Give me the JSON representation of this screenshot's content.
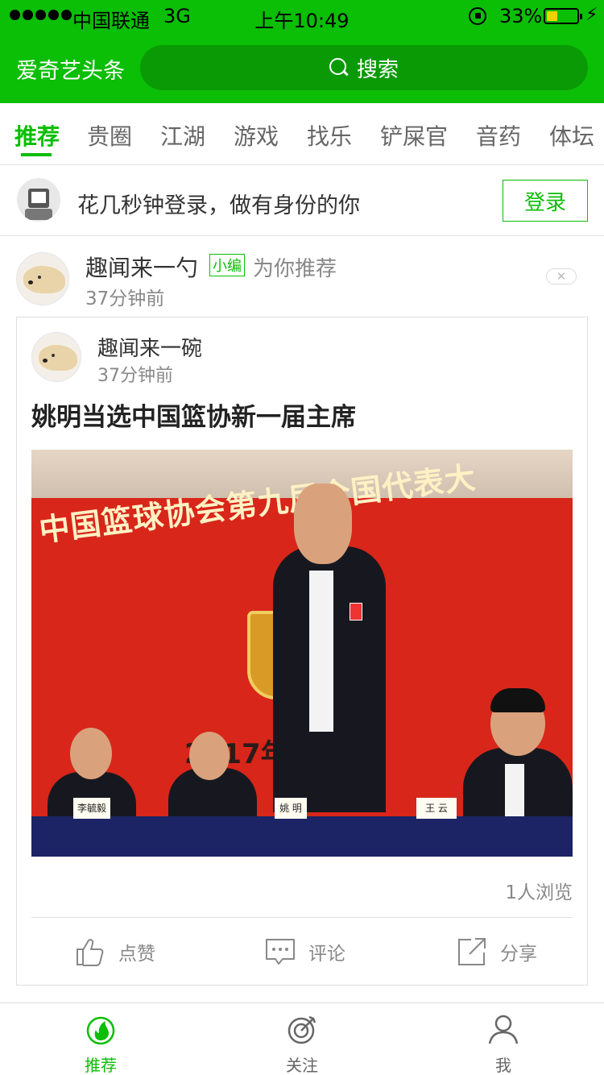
{
  "status_bar": {
    "carrier": "中国联通",
    "network": "3G",
    "time": "上午10:49",
    "battery": "33%"
  },
  "header": {
    "app_title": "爱奇艺头条",
    "search_label": "搜索"
  },
  "tabs": [
    {
      "label": "推荐",
      "active": true
    },
    {
      "label": "贵圈"
    },
    {
      "label": "江湖"
    },
    {
      "label": "游戏"
    },
    {
      "label": "找乐"
    },
    {
      "label": "铲屎官"
    },
    {
      "label": "音药"
    },
    {
      "label": "体坛"
    }
  ],
  "login_bar": {
    "text": "花几秒钟登录，做有身份的你",
    "button": "登录"
  },
  "feed_header": {
    "name": "趣闻来一勺",
    "tag": "小编",
    "recommend": "为你推荐",
    "time": "37分钟前"
  },
  "card": {
    "author": "趣闻来一碗",
    "time": "37分钟前",
    "title": "姚明当选中国篮协新一届主席",
    "photo": {
      "banner": "中国篮球协会第九届全国代表大",
      "year": "2017年2月",
      "nameplates": [
        "李毓毅",
        "姚 明",
        "王 云"
      ]
    },
    "views": "1人浏览",
    "actions": {
      "like": "点赞",
      "comment": "评论",
      "share": "分享"
    }
  },
  "bottom_nav": [
    {
      "label": "推荐",
      "icon": "fire-icon",
      "active": true
    },
    {
      "label": "关注",
      "icon": "target-icon"
    },
    {
      "label": "我",
      "icon": "person-icon"
    }
  ],
  "colors": {
    "brand_green": "#0bbe06",
    "search_bg": "#0a9a05",
    "photo_red": "#d8261a"
  }
}
